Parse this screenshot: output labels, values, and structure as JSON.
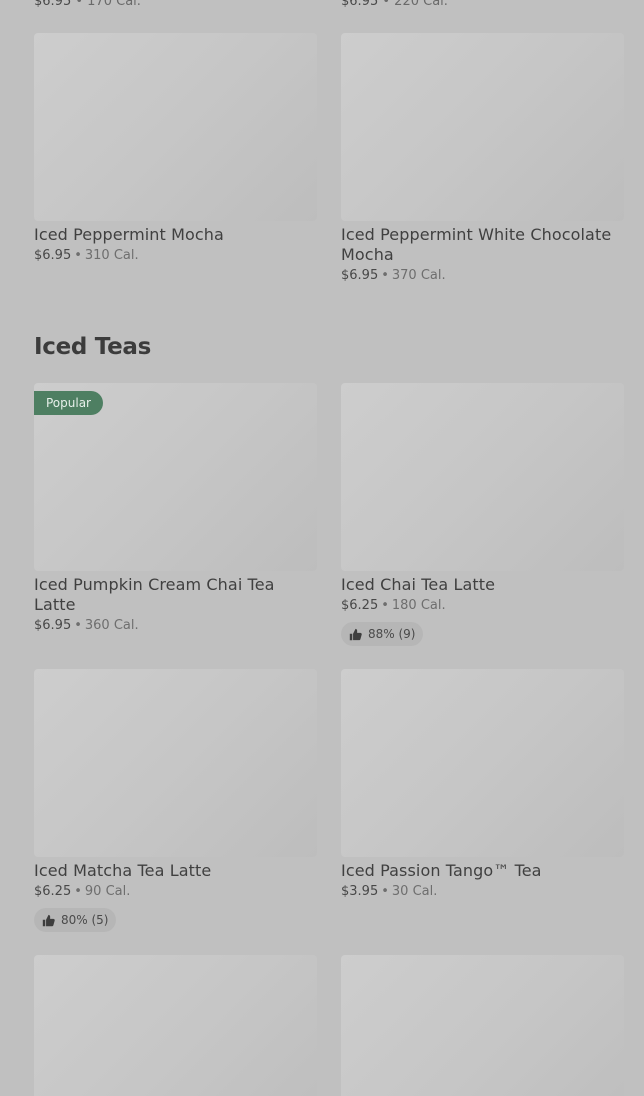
{
  "top_partial": [
    {
      "price": "$6.95",
      "calories": "170 Cal."
    },
    {
      "price": "$6.95",
      "calories": "220 Cal."
    }
  ],
  "row1": [
    {
      "name": "Iced Peppermint Mocha",
      "price": "$6.95",
      "calories": "310 Cal."
    },
    {
      "name": "Iced Peppermint White Chocolate Mocha",
      "price": "$6.95",
      "calories": "370 Cal."
    }
  ],
  "section": {
    "title": "Iced Teas"
  },
  "teas": [
    {
      "name": "Iced Pumpkin Cream Chai Tea Latte",
      "price": "$6.95",
      "calories": "360 Cal.",
      "badge": "Popular"
    },
    {
      "name": "Iced Chai Tea Latte",
      "price": "$6.25",
      "calories": "180 Cal.",
      "rating": "88% (9)"
    },
    {
      "name": "Iced Matcha Tea Latte",
      "price": "$6.25",
      "calories": "90 Cal.",
      "rating": "80% (5)"
    },
    {
      "name": "Iced Passion Tango™ Tea",
      "price": "$3.95",
      "calories": "30 Cal."
    }
  ],
  "separator": "•",
  "icons": {
    "rating": "thumbs-up-icon"
  }
}
